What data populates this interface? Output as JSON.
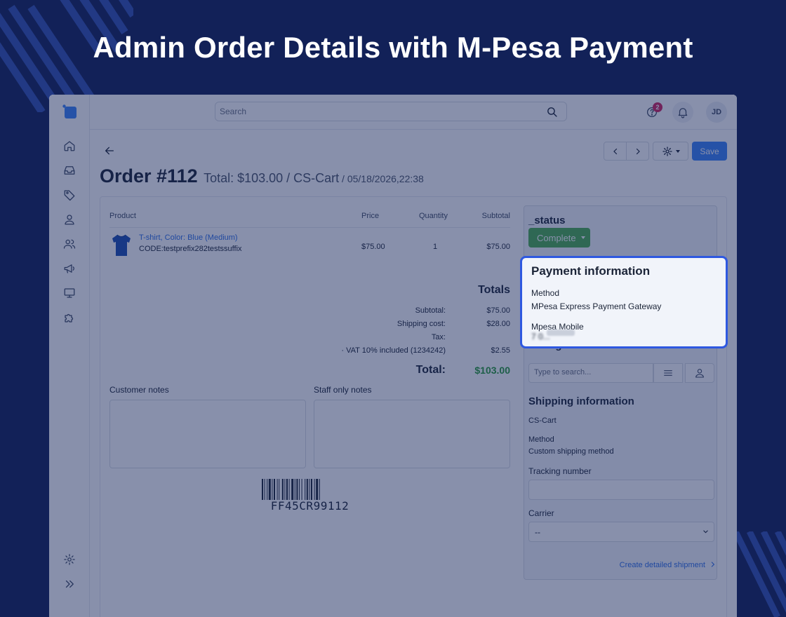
{
  "promo": {
    "title": "Admin Order Details with M-Pesa Payment"
  },
  "colors": {
    "background": "#122158",
    "accent": "#3b82f6",
    "status_complete": "#4caf50",
    "highlight_border": "#2e58e0",
    "total_green": "#2a9d3a"
  },
  "topbar": {
    "search_placeholder": "Search",
    "notification_count": "2",
    "avatar_initials": "JD",
    "icons": [
      "search-icon",
      "help-icon",
      "bell-icon"
    ]
  },
  "sidebar": {
    "icons": [
      "home-icon",
      "inbox-icon",
      "tag-icon",
      "user-icon",
      "users-icon",
      "megaphone-icon",
      "monitor-icon",
      "puzzle-icon",
      "settings-icon",
      "expand-icon"
    ]
  },
  "toolbar": {
    "save_label": "Save"
  },
  "order": {
    "number": "Order #112",
    "summary": "Total: $103.00 / CS-Cart",
    "date": " / 05/18/2026,22:38"
  },
  "products": {
    "headers": {
      "product": "Product",
      "price": "Price",
      "quantity": "Quantity",
      "subtotal": "Subtotal"
    },
    "items": [
      {
        "name": "T-shirt, Color: Blue (Medium)",
        "code": "CODE:testprefix282testssuffix",
        "price": "$75.00",
        "quantity": "1",
        "subtotal": "$75.00"
      }
    ]
  },
  "totals": {
    "heading": "Totals",
    "rows": [
      {
        "label": "Subtotal:",
        "value": "$75.00"
      },
      {
        "label": "Shipping cost:",
        "value": "$28.00"
      },
      {
        "label": "Tax:",
        "value": ""
      },
      {
        "label": "· VAT 10% included (1234242)",
        "value": "$2.55"
      }
    ],
    "total_label": "Total:",
    "total_value": "$103.00"
  },
  "notes": {
    "customer_label": "Customer notes",
    "staff_label": "Staff only notes"
  },
  "barcode": {
    "text": "FF45CR99112"
  },
  "status": {
    "heading": "_status",
    "value": "Complete"
  },
  "payment": {
    "heading": "Payment information",
    "method_label": "Method",
    "method_value": "MPesa Express Payment Gateway",
    "mobile_label": "Mpesa Mobile",
    "mobile_value": "7 0..."
  },
  "manager": {
    "heading": "Manager",
    "search_placeholder": "Type to search..."
  },
  "shipping": {
    "heading": "Shipping information",
    "store": "CS-Cart",
    "method_label": "Method",
    "method_value": "Custom shipping method",
    "tracking_label": "Tracking number",
    "carrier_label": "Carrier",
    "carrier_value": "--",
    "link": "Create detailed shipment"
  }
}
